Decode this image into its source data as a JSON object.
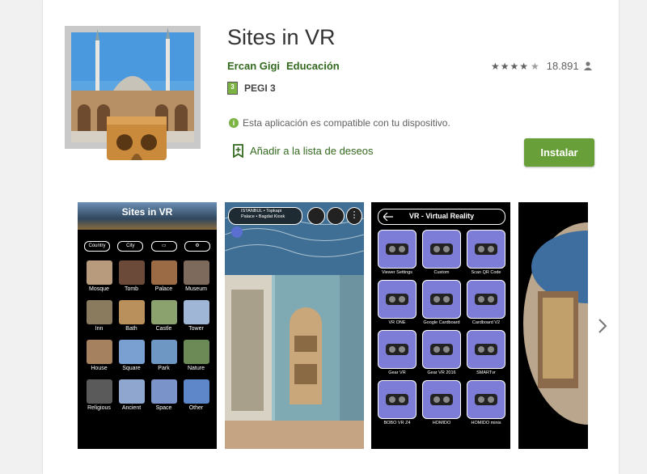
{
  "app": {
    "title": "Sites in VR",
    "developer": "Ercan Gigi",
    "category": "Educación",
    "rating_count": "18.891",
    "pegi_number": "3",
    "pegi": "PEGI 3",
    "compat": "Esta aplicación es compatible con tu dispositivo.",
    "wishlist": "Añadir a la lista de deseos",
    "install": "Instalar",
    "stars": 4.5
  },
  "colors": {
    "accent": "#689f38",
    "link": "#33691e"
  },
  "shot1": {
    "title": "Sites in VR",
    "pills": [
      "Country",
      "City"
    ],
    "items": [
      {
        "label": "Mosque",
        "color": "#b79b7c"
      },
      {
        "label": "Tomb",
        "color": "#6c4a3a"
      },
      {
        "label": "Palace",
        "color": "#9b6b45"
      },
      {
        "label": "Museum",
        "color": "#7d6a5c"
      },
      {
        "label": "Inn",
        "color": "#8a7a5e"
      },
      {
        "label": "Bath",
        "color": "#b98f5c"
      },
      {
        "label": "Castle",
        "color": "#8ba16e"
      },
      {
        "label": "Tower",
        "color": "#9fb6d6"
      },
      {
        "label": "House",
        "color": "#a68160"
      },
      {
        "label": "Square",
        "color": "#7aa0d2"
      },
      {
        "label": "Park",
        "color": "#6e97c4"
      },
      {
        "label": "Nature",
        "color": "#6b8a56"
      },
      {
        "label": "Religious",
        "color": "#5a5a5a"
      },
      {
        "label": "Ancient",
        "color": "#8fa7cf"
      },
      {
        "label": "Space",
        "color": "#7a93c9"
      },
      {
        "label": "Other",
        "color": "#5d87c9"
      }
    ]
  },
  "shot2": {
    "place": "ISTANBUL • Topkapi\nPalace • Bagdat Kiosk"
  },
  "shot3": {
    "title": "VR - Virtual Reality",
    "items": [
      "Viewer Settings",
      "Custom",
      "Scan QR Code",
      "VR ONE",
      "Google Cardboard",
      "Cardboard V2",
      "Gear VR",
      "Gear VR 2016",
      "SMARTvr",
      "BOBO VR Z4",
      "HOMIDO",
      "HOMIDO minis"
    ]
  }
}
